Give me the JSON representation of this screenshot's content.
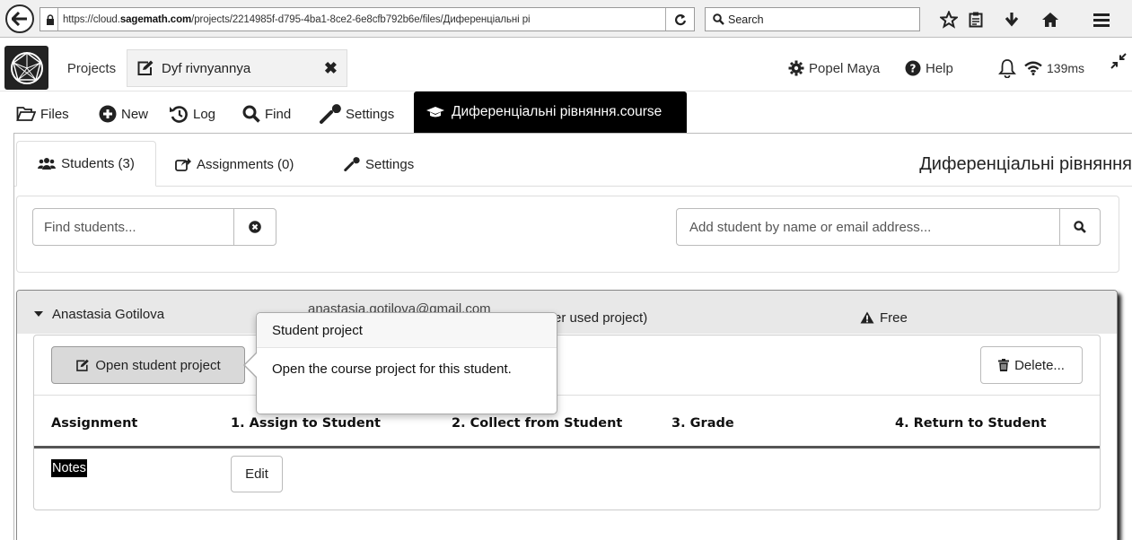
{
  "browser": {
    "url_prefix": "https://cloud.",
    "url_domain": "sagemath.com",
    "url_rest": "/projects/2214985f-d795-4ba1-8ce2-6e8cfb792b6e/files/Диференціальні рі",
    "search_placeholder": "Search"
  },
  "app": {
    "projects_label": "Projects",
    "file_tab_label": "Dyf rivnyannya",
    "user_label": "Popel Maya",
    "help_label": "Help",
    "ping_label": "139ms"
  },
  "projnav": {
    "files": "Files",
    "new": "New",
    "log": "Log",
    "find": "Find",
    "settings": "Settings",
    "course_file": "Диференціальні рівняння.course"
  },
  "course": {
    "tabs": {
      "students": "Students (3)",
      "assignments": "Assignments (0)",
      "settings": "Settings"
    },
    "title": "Диференціальні рівняння",
    "find_placeholder": "Find students...",
    "add_placeholder": "Add student by name or email address..."
  },
  "student": {
    "name": "Anastasia Gotilova",
    "email": "anastasia.gotilova@gmail.com",
    "last_used": "er used project)",
    "plan": "Free",
    "open_button": "Open student project",
    "delete_button": "Delete...",
    "columns": [
      "Assignment",
      "1. Assign to Student",
      "2. Collect from Student",
      "3. Grade",
      "4. Return to Student"
    ],
    "rows": [
      {
        "assignment": "Notes",
        "action": "Edit"
      }
    ]
  },
  "popover": {
    "title": "Student project",
    "body": "Open the course project for this student."
  },
  "colors": {
    "accent_black": "#000000",
    "header_gray": "#e8e8e8",
    "button_gray": "#d9d9d9"
  }
}
